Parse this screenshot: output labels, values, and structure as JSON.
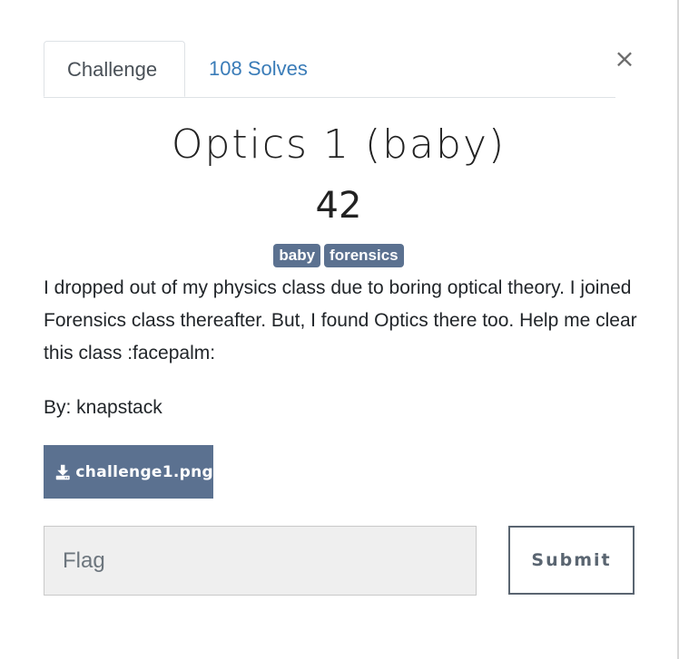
{
  "modal": {
    "close_label": "×",
    "tabs": [
      {
        "label": "Challenge"
      },
      {
        "label": "108 Solves"
      }
    ],
    "challenge": {
      "title": "Optics 1 (baby)",
      "points": "42",
      "tags": [
        "baby",
        "forensics"
      ],
      "description": "I dropped out of my physics class due to boring optical theory. I joined Forensics class thereafter. But, I found Optics there too. Help me clear this class :facepalm:",
      "author": "By: knapstack",
      "file": {
        "label": "challenge1.png",
        "icon": "download-icon"
      }
    },
    "flag": {
      "placeholder": "Flag",
      "value": ""
    },
    "submit_label": "Submit"
  },
  "colors": {
    "accent": "#5b7190",
    "link": "#3a7cb8",
    "input_bg": "#efefef",
    "submit_border": "#5a6571"
  }
}
